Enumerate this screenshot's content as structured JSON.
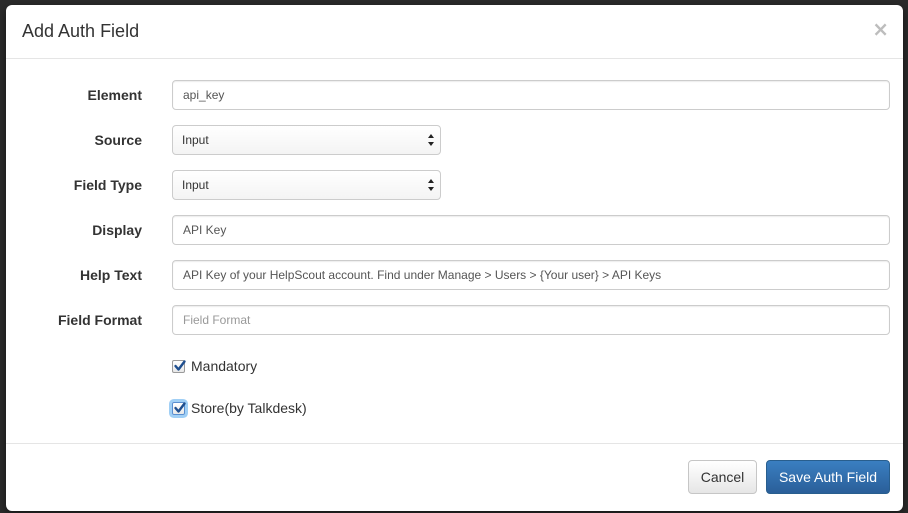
{
  "modal": {
    "title": "Add Auth Field",
    "close_label": "×"
  },
  "form": {
    "element": {
      "label": "Element",
      "value": "api_key",
      "placeholder": ""
    },
    "source": {
      "label": "Source",
      "selected": "Input"
    },
    "field_type": {
      "label": "Field Type",
      "selected": "Input"
    },
    "display": {
      "label": "Display",
      "value": "API Key",
      "placeholder": ""
    },
    "help_text": {
      "label": "Help Text",
      "value": "API Key of your HelpScout account. Find under Manage > Users > {Your user} > API Keys",
      "placeholder": ""
    },
    "field_format": {
      "label": "Field Format",
      "value": "",
      "placeholder": "Field Format"
    },
    "mandatory": {
      "label": "Mandatory",
      "checked": true
    },
    "store": {
      "label": "Store(by Talkdesk)",
      "checked": true
    }
  },
  "footer": {
    "cancel_label": "Cancel",
    "save_label": "Save Auth Field"
  },
  "colors": {
    "primary": "#2a6aa8",
    "check": "#1f4f8f"
  }
}
